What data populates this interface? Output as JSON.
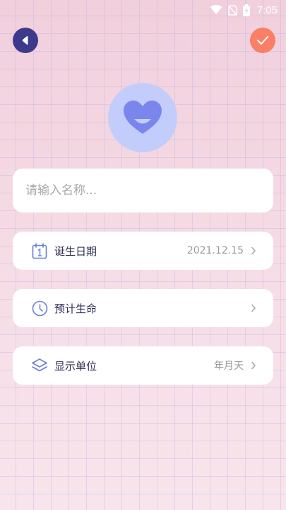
{
  "status_bar": {
    "time": "7:05",
    "icons": [
      "wifi-icon",
      "no-sim-icon",
      "battery-charging-icon"
    ]
  },
  "header": {
    "back_icon": "back-arrow-icon",
    "confirm_icon": "checkmark-icon",
    "back_color": "#3d3a8c",
    "confirm_color": "#f97f66"
  },
  "avatar": {
    "icon": "heart-face-icon",
    "bg_color": "#c3cdfb",
    "icon_color": "#7b86ec"
  },
  "name_field": {
    "value": "",
    "placeholder": "请输入名称..."
  },
  "rows": [
    {
      "icon": "calendar-icon",
      "label": "诞生日期",
      "value": "2021.12.15"
    },
    {
      "icon": "clock-icon",
      "label": "预计生命",
      "value": ""
    },
    {
      "icon": "layers-icon",
      "label": "显示单位",
      "value": "年月天"
    }
  ],
  "colors": {
    "accent": "#6b7fd7",
    "label_text": "#2d2d55",
    "value_text": "#9a9a9a"
  }
}
